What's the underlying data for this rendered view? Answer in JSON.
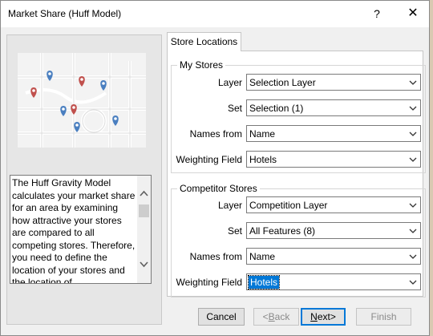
{
  "window": {
    "title": "Market Share (Huff Model)",
    "help_label": "?",
    "close_label": "✕"
  },
  "map_preview": {
    "icon": "map-pins-preview",
    "pin_colors": {
      "my_store": "#4a7fc0",
      "competitor": "#c0504d"
    }
  },
  "description": "The Huff Gravity Model calculates your market share for an area by examining how attractive your stores are compared to all competing stores. Therefore, you need to define the location of your stores and the location of",
  "tab": {
    "label": "Store Locations"
  },
  "my_stores": {
    "title": "My Stores",
    "layer": {
      "label": "Layer",
      "value": "Selection Layer"
    },
    "set": {
      "label": "Set",
      "value": "Selection (1)"
    },
    "names_from": {
      "label": "Names from",
      "value": "Name"
    },
    "weighting": {
      "label": "Weighting Field",
      "value": "Hotels"
    }
  },
  "competitor_stores": {
    "title": "Competitor Stores",
    "layer": {
      "label": "Layer",
      "value": "Competition Layer"
    },
    "set": {
      "label": "Set",
      "value": "All Features (8)"
    },
    "names_from": {
      "label": "Names from",
      "value": "Name"
    },
    "weighting": {
      "label": "Weighting Field",
      "value": "Hotels"
    }
  },
  "buttons": {
    "cancel": "Cancel",
    "back_hotkey": "B",
    "back_rest": "ack",
    "back_prefix": "<",
    "next_hotkey": "N",
    "next_rest": "ext>",
    "finish": "Finish"
  },
  "colors": {
    "accent": "#0078d7",
    "dialog_bg": "#f0f0f0"
  }
}
